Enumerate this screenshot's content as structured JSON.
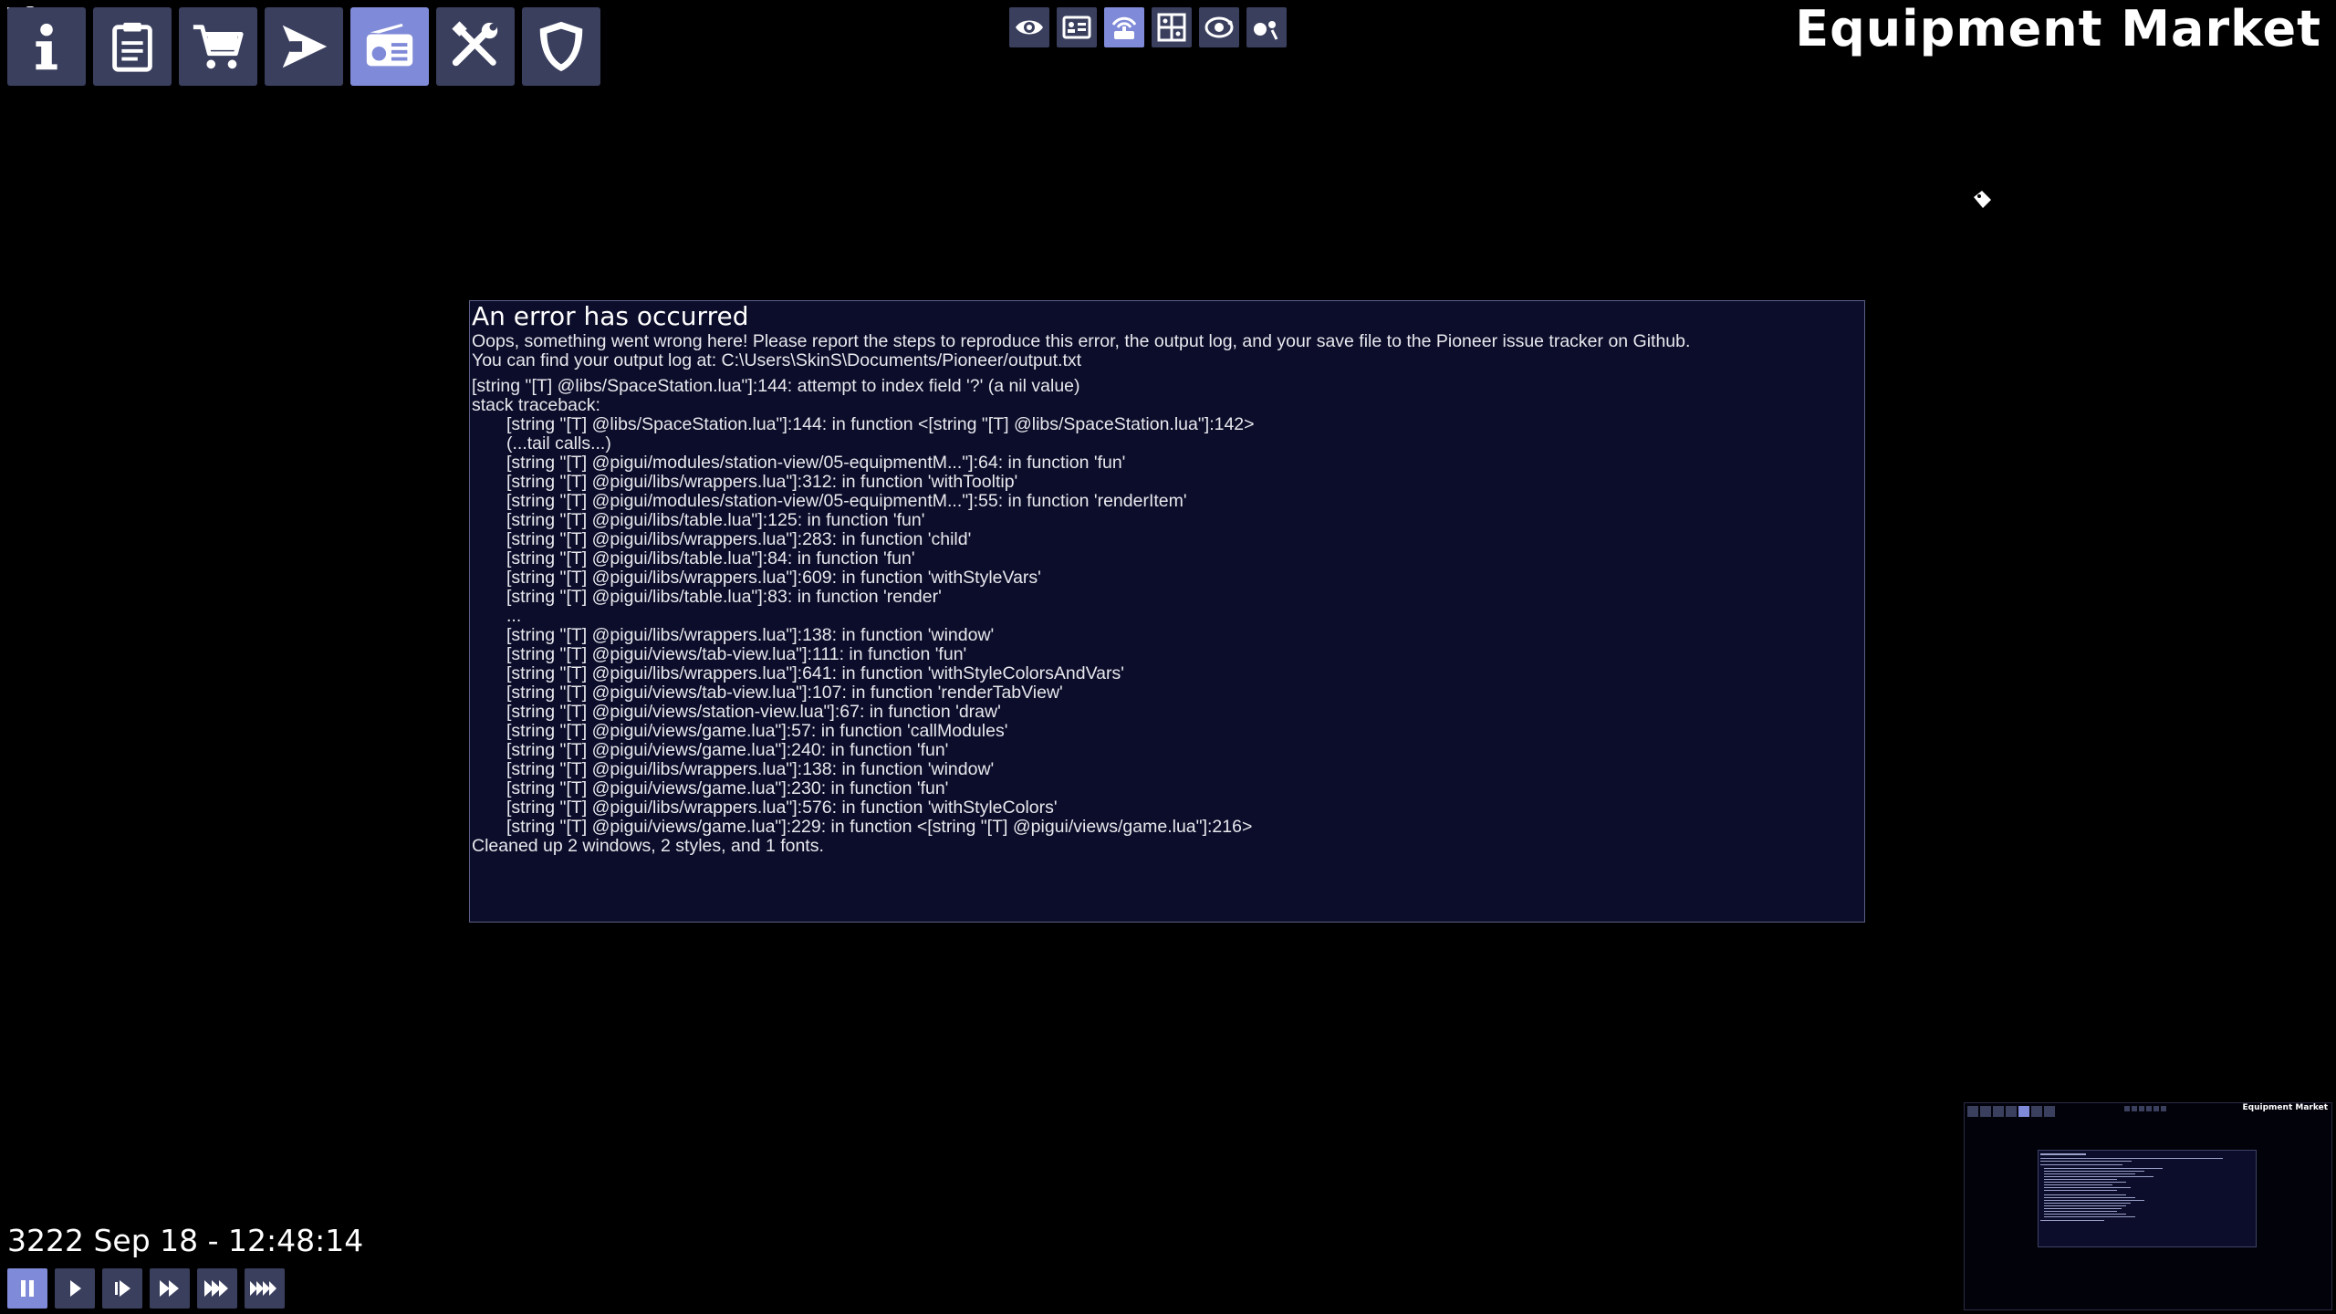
{
  "station_tabs": [
    {
      "name": "info",
      "icon": "info-icon",
      "active": false
    },
    {
      "name": "bulletin-board",
      "icon": "clipboard-icon",
      "active": false
    },
    {
      "name": "commodity-market",
      "icon": "cart-icon",
      "active": false
    },
    {
      "name": "shipyard",
      "icon": "ship-icon",
      "active": false
    },
    {
      "name": "equipment-market",
      "icon": "radio-icon",
      "active": true
    },
    {
      "name": "ship-repairs",
      "icon": "tools-icon",
      "active": false
    },
    {
      "name": "police",
      "icon": "shield-icon",
      "active": false
    }
  ],
  "view_tools": [
    {
      "icon": "eye-icon",
      "active": false
    },
    {
      "icon": "id-card-icon",
      "active": false
    },
    {
      "icon": "comms-icon",
      "active": true
    },
    {
      "icon": "sector-map-icon",
      "active": false
    },
    {
      "icon": "system-orbit-icon",
      "active": false
    },
    {
      "icon": "info-view-icon",
      "active": false
    }
  ],
  "view_title": "Equipment Market",
  "error": {
    "title": "An error has occurred",
    "message_1": "Oops, something went wrong here! Please report the steps to reproduce this error, the output log, and your save file to the Pioneer issue tracker on Github.",
    "message_2": "You can find your output log at: C:\\Users\\SkinS\\Documents/Pioneer/output.txt",
    "error_line": "[string \"[T] @libs/SpaceStation.lua\"]:144: attempt to index field '?' (a nil value)",
    "traceback_header": "stack traceback:",
    "traceback": [
      "[string \"[T] @libs/SpaceStation.lua\"]:144: in function <[string \"[T] @libs/SpaceStation.lua\"]:142>",
      "(...tail calls...)",
      "[string \"[T] @pigui/modules/station-view/05-equipmentM...\"]:64: in function 'fun'",
      "[string \"[T] @pigui/libs/wrappers.lua\"]:312: in function 'withTooltip'",
      "[string \"[T] @pigui/modules/station-view/05-equipmentM...\"]:55: in function 'renderItem'",
      "[string \"[T] @pigui/libs/table.lua\"]:125: in function 'fun'",
      "[string \"[T] @pigui/libs/wrappers.lua\"]:283: in function 'child'",
      "[string \"[T] @pigui/libs/table.lua\"]:84: in function 'fun'",
      "[string \"[T] @pigui/libs/wrappers.lua\"]:609: in function 'withStyleVars'",
      "[string \"[T] @pigui/libs/table.lua\"]:83: in function 'render'",
      "...",
      "[string \"[T] @pigui/libs/wrappers.lua\"]:138: in function 'window'",
      "[string \"[T] @pigui/views/tab-view.lua\"]:111: in function 'fun'",
      "[string \"[T] @pigui/libs/wrappers.lua\"]:641: in function 'withStyleColorsAndVars'",
      "[string \"[T] @pigui/views/tab-view.lua\"]:107: in function 'renderTabView'",
      "[string \"[T] @pigui/views/station-view.lua\"]:67: in function 'draw'",
      "[string \"[T] @pigui/views/game.lua\"]:57: in function 'callModules'",
      "[string \"[T] @pigui/views/game.lua\"]:240: in function 'fun'",
      "[string \"[T] @pigui/libs/wrappers.lua\"]:138: in function 'window'",
      "[string \"[T] @pigui/views/game.lua\"]:230: in function 'fun'",
      "[string \"[T] @pigui/libs/wrappers.lua\"]:576: in function 'withStyleColors'",
      "[string \"[T] @pigui/views/game.lua\"]:229: in function <[string \"[T] @pigui/views/game.lua\"]:216>"
    ],
    "cleanup": "Cleaned up 2 windows, 2 styles, and 1 fonts."
  },
  "game_date": "3222 Sep 18 - 12:48:14",
  "time_controls": [
    {
      "name": "pause",
      "icon": "pause-icon",
      "active": true
    },
    {
      "name": "normal",
      "icon": "play-icon",
      "active": false
    },
    {
      "name": "fast",
      "icon": "fast-forward-1-icon",
      "active": false
    },
    {
      "name": "faster",
      "icon": "fast-forward-2-icon",
      "active": false
    },
    {
      "name": "very-fast",
      "icon": "fast-forward-3-icon",
      "active": false
    },
    {
      "name": "hyper",
      "icon": "fast-forward-4-icon",
      "active": false
    }
  ],
  "colors": {
    "button": "#3a3f5e",
    "button_active": "#7f8ad8",
    "window_bg": "#0c0d2a",
    "window_border": "#5b5f86"
  }
}
